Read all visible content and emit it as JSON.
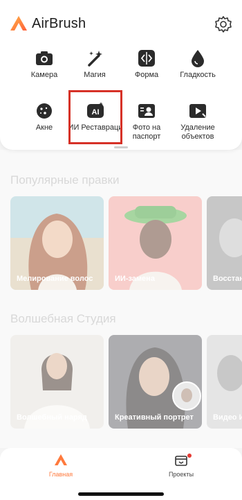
{
  "header": {
    "title": "AirBrush"
  },
  "tools": [
    {
      "label": "Камера",
      "icon": "camera-icon"
    },
    {
      "label": "Магия",
      "icon": "magic-wand-icon"
    },
    {
      "label": "Форма",
      "icon": "reshape-icon"
    },
    {
      "label": "Гладкость",
      "icon": "drop-icon"
    },
    {
      "label": "Акне",
      "icon": "acne-icon"
    },
    {
      "label": "ИИ Реставраци",
      "icon": "ai-restore-icon"
    },
    {
      "label": "Фото на паспорт",
      "icon": "passport-photo-icon"
    },
    {
      "label": "Удаление объектов",
      "icon": "object-removal-icon"
    }
  ],
  "popular": {
    "title": "Популярные правки",
    "cards": [
      {
        "caption": "Мелирование волос"
      },
      {
        "caption": "ИИ-замена"
      },
      {
        "caption": "Восстан"
      }
    ]
  },
  "studio": {
    "title": "Волшебная Студия",
    "cards": [
      {
        "caption": "Волшебный наряд"
      },
      {
        "caption": "Креативный портрет"
      },
      {
        "caption": "Видео И"
      }
    ]
  },
  "nav": {
    "home": "Главная",
    "projects": "Проекты"
  },
  "colors": {
    "accent": "#ff7a3d",
    "highlight": "#d63127",
    "badge": "#e53a33"
  }
}
